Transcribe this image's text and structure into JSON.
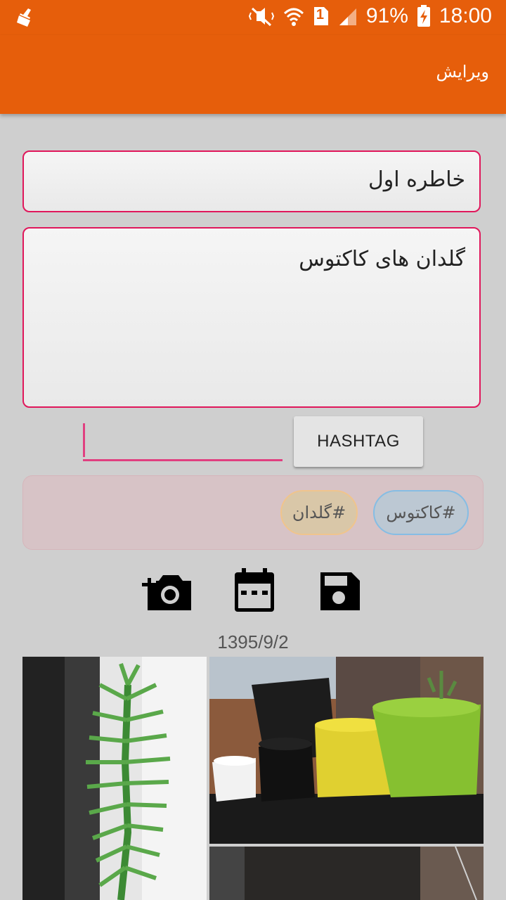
{
  "status_bar": {
    "battery": "91%",
    "time": "18:00",
    "sim_slot": "1",
    "icons": [
      "cleaner-icon",
      "mute-icon",
      "wifi-icon",
      "sim-icon",
      "signal-icon",
      "battery-icon"
    ]
  },
  "app_bar": {
    "title": "ویرایش"
  },
  "memory": {
    "title_value": "خاطره اول",
    "body_value": "گلدان های کاکتوس"
  },
  "hashtag": {
    "input_value": "",
    "button_label": "HASHTAG",
    "tags": [
      "#کاکتوس",
      "#گلدان"
    ]
  },
  "toolbar": {
    "icons": [
      "add-photo-icon",
      "calendar-icon",
      "save-icon"
    ]
  },
  "date": "1395/9/2",
  "colors": {
    "accent": "#e65e0b",
    "field_border": "#e0175b",
    "chip_blue_border": "#85bde4",
    "chip_orange_border": "#f0c48c"
  }
}
